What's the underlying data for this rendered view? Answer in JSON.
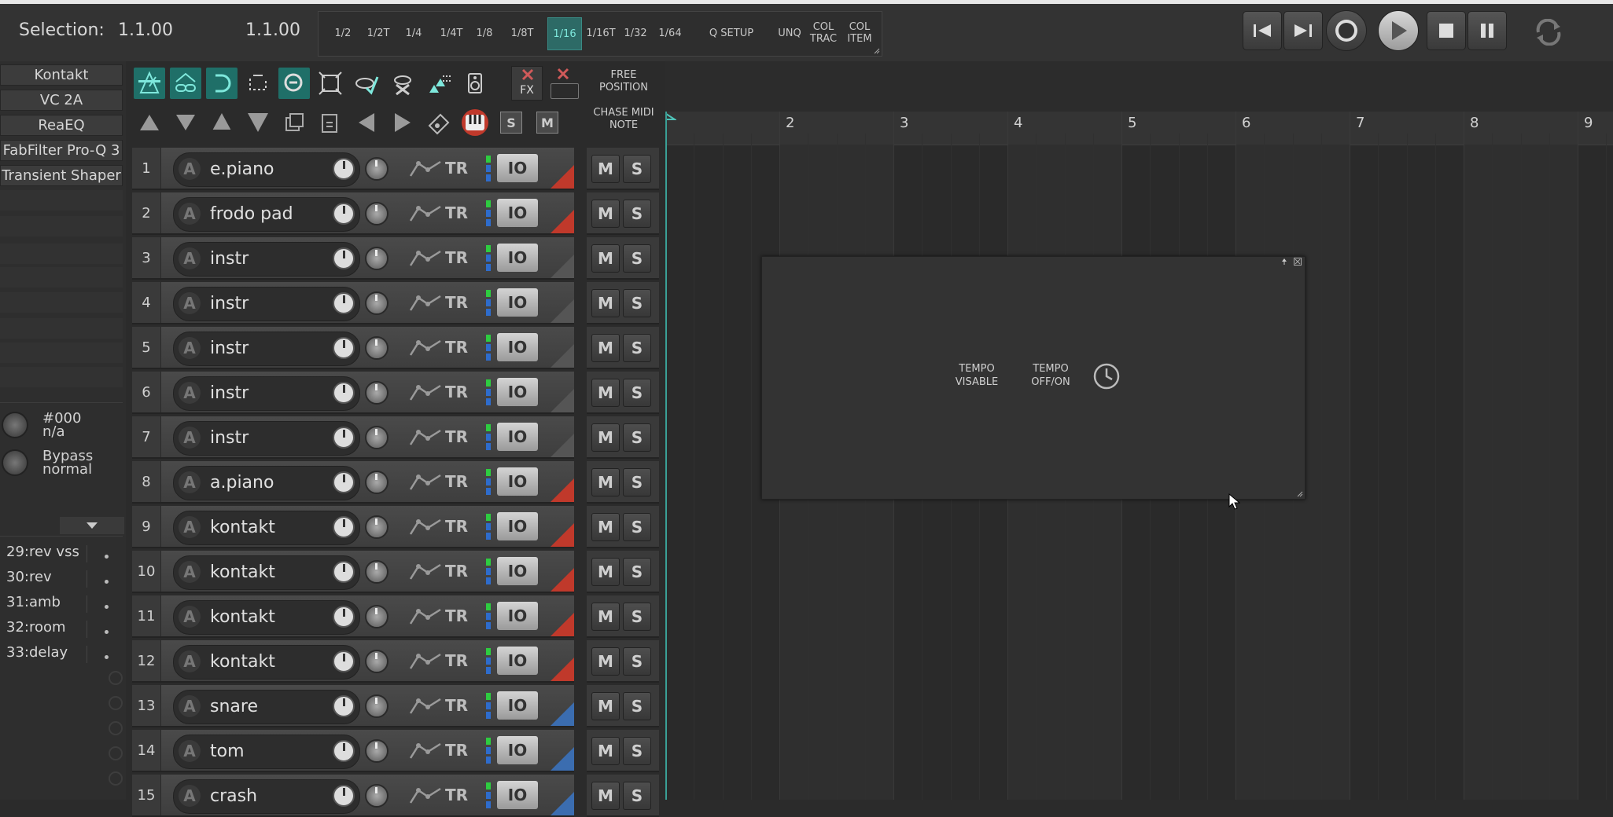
{
  "selection": {
    "label": "Selection:",
    "start": "1.1.00",
    "end": "1.1.00"
  },
  "grid_buttons": [
    {
      "label": "1/2"
    },
    {
      "label": "1/2T"
    },
    {
      "label": "1/4"
    },
    {
      "label": "1/4T"
    },
    {
      "label": "1/8"
    },
    {
      "label": "1/8T"
    },
    {
      "label": "1/16"
    },
    {
      "label": "1/16T"
    },
    {
      "label": "1/32"
    },
    {
      "label": "1/64"
    },
    {
      "label": "Q SETUP"
    },
    {
      "label": "UNQ"
    },
    {
      "label": "COL TRAC"
    },
    {
      "label": "COL ITEM"
    }
  ],
  "grid_active": "1/16",
  "fx_chain": [
    "Kontakt",
    "VC 2A",
    "ReaEQ",
    "FabFilter Pro-Q 3",
    "Transient Shaper"
  ],
  "params": [
    {
      "line1": "#000",
      "line2": "n/a"
    },
    {
      "line1": "Bypass",
      "line2": "normal"
    }
  ],
  "sends": [
    "29:rev vss",
    "30:rev",
    "31:amb",
    "32:room",
    "33:delay"
  ],
  "toolbar": {
    "fx_label": "FX",
    "free_position": "FREE POSITION",
    "chase_midi": "CHASE MIDI NOTE"
  },
  "track_button_labels": {
    "tr": "TR",
    "io": "IO",
    "mute": "M",
    "solo": "S",
    "a": "A"
  },
  "tracks": [
    {
      "num": "1",
      "name": "e.piano",
      "color": "#c0392b"
    },
    {
      "num": "2",
      "name": "frodo pad",
      "color": "#c0392b"
    },
    {
      "num": "3",
      "name": "instr",
      "color": "#555555"
    },
    {
      "num": "4",
      "name": "instr",
      "color": "#555555"
    },
    {
      "num": "5",
      "name": "instr",
      "color": "#555555"
    },
    {
      "num": "6",
      "name": "instr",
      "color": "#555555"
    },
    {
      "num": "7",
      "name": "instr",
      "color": "#555555"
    },
    {
      "num": "8",
      "name": "a.piano",
      "color": "#c0392b"
    },
    {
      "num": "9",
      "name": "kontakt",
      "color": "#c0392b"
    },
    {
      "num": "10",
      "name": "kontakt",
      "color": "#c0392b"
    },
    {
      "num": "11",
      "name": "kontakt",
      "color": "#c0392b"
    },
    {
      "num": "12",
      "name": "kontakt",
      "color": "#c0392b"
    },
    {
      "num": "13",
      "name": "snare",
      "color": "#3b6db0"
    },
    {
      "num": "14",
      "name": "tom",
      "color": "#3b6db0"
    },
    {
      "num": "15",
      "name": "crash",
      "color": "#3b6db0"
    }
  ],
  "ruler_bars": [
    "2",
    "3",
    "4",
    "5",
    "6",
    "7",
    "8",
    "9"
  ],
  "tempo_window": {
    "visable": "TEMPO VISABLE",
    "offon": "TEMPO OFF/ON"
  }
}
